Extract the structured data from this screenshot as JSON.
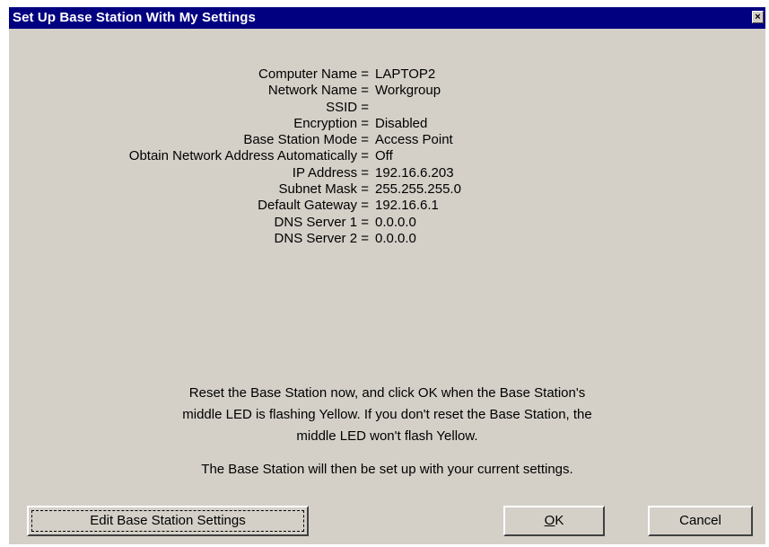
{
  "window": {
    "title": "Set Up Base Station With My Settings",
    "close_glyph": "×"
  },
  "settings": [
    {
      "label": "Computer Name =",
      "value": "LAPTOP2"
    },
    {
      "label": "Network Name =",
      "value": "Workgroup"
    },
    {
      "label": "SSID =",
      "value": ""
    },
    {
      "label": "Encryption =",
      "value": "Disabled"
    },
    {
      "label": "Base Station Mode =",
      "value": "Access Point"
    },
    {
      "label": "Obtain Network Address Automatically =",
      "value": "Off"
    },
    {
      "label": "IP Address =",
      "value": "192.16.6.203"
    },
    {
      "label": "Subnet Mask =",
      "value": "255.255.255.0"
    },
    {
      "label": "Default Gateway =",
      "value": "192.16.6.1"
    },
    {
      "label": "DNS Server 1 =",
      "value": "0.0.0.0"
    },
    {
      "label": "DNS Server 2 =",
      "value": "0.0.0.0"
    }
  ],
  "messages": {
    "reset_line1": "Reset the Base Station now, and click OK when the Base Station's",
    "reset_line2": "middle LED is flashing Yellow. If you don't reset the Base Station, the",
    "reset_line3": "middle LED won't flash Yellow.",
    "setup": "The Base Station will then be set up with your current settings."
  },
  "buttons": {
    "edit_label": "Edit Base Station Settings",
    "ok_mnemonic": "O",
    "ok_rest": "K",
    "cancel_label": "Cancel"
  },
  "colors": {
    "titlebar": "#000080",
    "face": "#d4d0c8"
  }
}
